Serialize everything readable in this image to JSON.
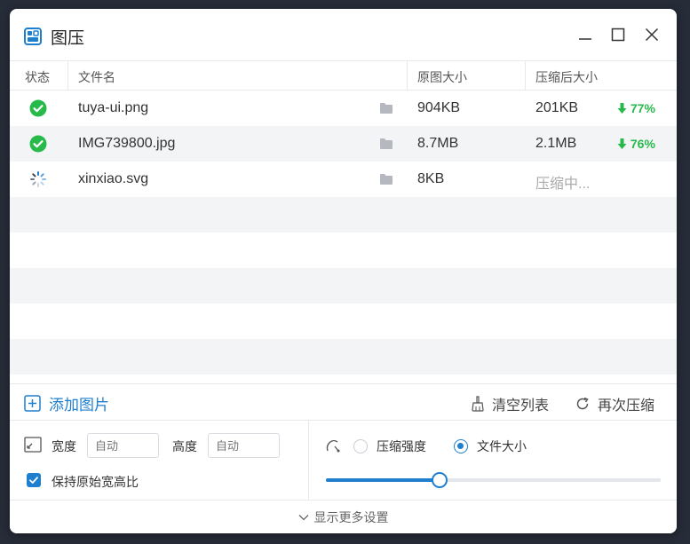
{
  "app": {
    "title": "图压"
  },
  "table": {
    "headers": {
      "status": "状态",
      "filename": "文件名",
      "original": "原图大小",
      "compressed": "压缩后大小"
    },
    "rows": [
      {
        "status": "done",
        "name": "tuya-ui.png",
        "original": "904KB",
        "compressed": "201KB",
        "percent": "77%"
      },
      {
        "status": "done",
        "name": "IMG739800.jpg",
        "original": "8.7MB",
        "compressed": "2.1MB",
        "percent": "76%"
      },
      {
        "status": "loading",
        "name": "xinxiao.svg",
        "original": "8KB",
        "compressed": "压缩中...",
        "percent": ""
      }
    ]
  },
  "actions": {
    "add": "添加图片",
    "clear": "清空列表",
    "recompress": "再次压缩"
  },
  "settings": {
    "width_label": "宽度",
    "width_placeholder": "自动",
    "height_label": "高度",
    "height_placeholder": "自动",
    "keep_ratio_label": "保持原始宽高比",
    "keep_ratio_checked": true,
    "mode_quality_label": "压缩强度",
    "mode_size_label": "文件大小",
    "selected_mode": "size",
    "slider_fraction": 0.34
  },
  "more": {
    "label": "显示更多设置"
  },
  "colors": {
    "accent": "#1e7fcf",
    "success": "#27b94a",
    "row_alt": "#f3f4f6"
  }
}
